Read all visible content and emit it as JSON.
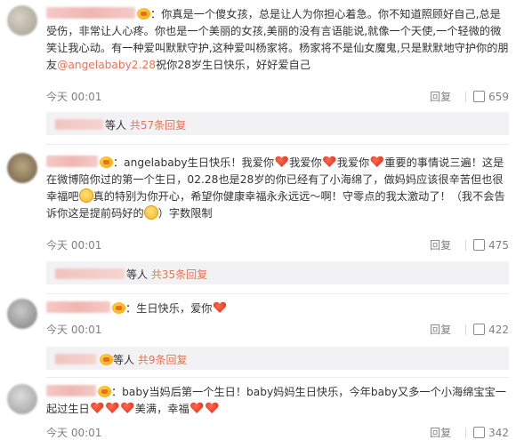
{
  "comments": [
    {
      "text_a": "：你真是一个傻女孩，总是让人为你担心着急。你不知道照顾好自己,总是受伤，非常让人心疼。你也是一个美丽的女孩,美丽的没有言语能说,就像一个天使,一个轻微的微笑让我心动。有一种爱叫默默守护,这种爱叫杨家将。杨家将不是仙女魔鬼,只是默默地守护你的朋友",
      "mention": "@angelababy2.28",
      "text_b": "祝你28岁生日快乐，好好爱自己",
      "time": "今天 00:01",
      "reply": "回复",
      "likes": "659",
      "sub_label": "等人",
      "sub_count": "共57条回复"
    },
    {
      "text_a": "：angelababy生日快乐！我爱你",
      "text_b": "我爱你",
      "text_c": "我爱你",
      "text_d": "重要的事情说三遍！这是在微博陪你过的第一个生日，02.28也是28岁的你已经有了小海绵了，做妈妈应该很辛苦但也很幸福吧",
      "text_e": "真的特别为你开心，希望你健康幸福永永远远～啊！守零点的我太激动了！（我不会告诉你这是提前码好的",
      "text_f": "）字数限制",
      "time": "今天 00:01",
      "reply": "回复",
      "likes": "475",
      "sub_label": "等人",
      "sub_count": "共35条回复"
    },
    {
      "text_a": "：生日快乐，爱你",
      "time": "今天 00:01",
      "reply": "回复",
      "likes": "422",
      "sub_label": "等人",
      "sub_count": "共9条回复"
    },
    {
      "text_a": "：baby当妈后第一个生日！baby妈妈生日快乐，今年baby又多一个小海绵宝宝一起过生日",
      "text_b": "美满，幸福",
      "time": "今天 00:01",
      "reply": "回复",
      "likes": "342"
    }
  ],
  "icons": [
    "vip-badge-icon",
    "heart-emoji-icon",
    "smile-emoji-icon",
    "thumbs-up-icon"
  ],
  "colors": {
    "accent": "#eb7350",
    "meta": "#808080",
    "sub_bg": "#f2f2f5"
  }
}
